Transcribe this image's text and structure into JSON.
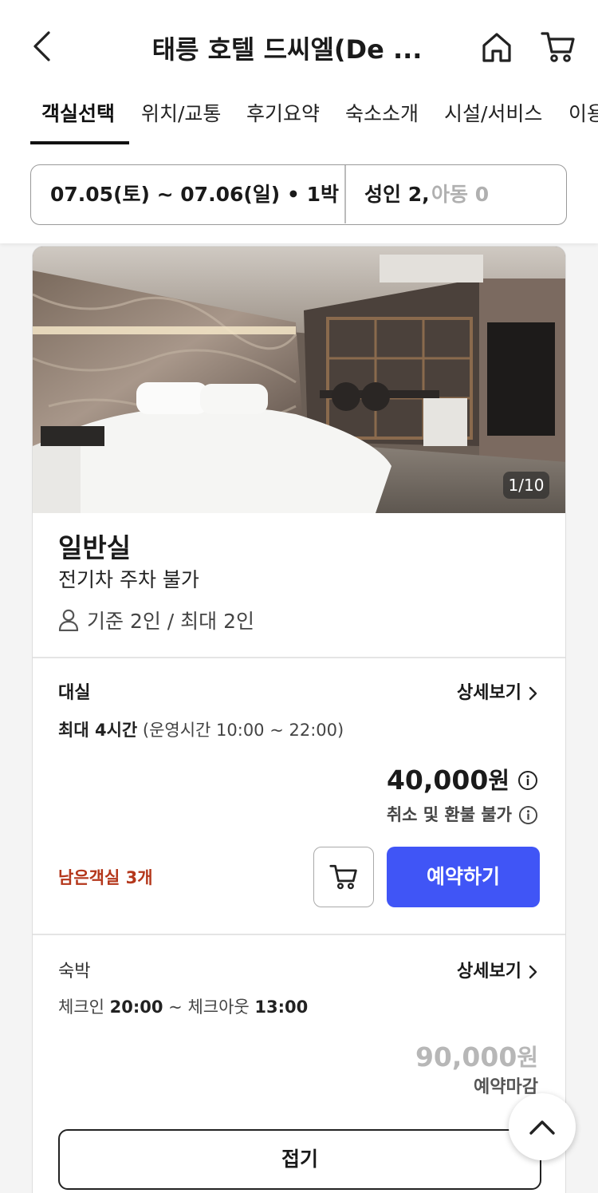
{
  "header": {
    "title": "태릉 호텔 드씨엘(De ...",
    "icons": {
      "back": "chevron-left-icon",
      "home": "home-icon",
      "cart": "cart-icon"
    }
  },
  "tabs": [
    {
      "label": "객실선택",
      "active": true
    },
    {
      "label": "위치/교통"
    },
    {
      "label": "후기요약"
    },
    {
      "label": "숙소소개"
    },
    {
      "label": "시설/서비스"
    },
    {
      "label": "이용"
    }
  ],
  "booking": {
    "dates": "07.05(토) ~ 07.06(일) • 1박",
    "adults": "성인 2,",
    "children": "아동 0"
  },
  "room": {
    "photo_counter": "1/10",
    "name": "일반실",
    "note": "전기차 주차 불가",
    "capacity": "기준 2인 / 최대 2인",
    "capacity_icon": "person-icon"
  },
  "offers": {
    "rental": {
      "title": "대실",
      "detail_label": "상세보기",
      "desc_bold": "최대 4시간",
      "desc_rest": " (운영시간 10:00 ~ 22:00)",
      "price": "40,000",
      "price_unit": "원",
      "policy": "취소 및 환불 불가",
      "remaining": "남은객실 3개",
      "reserve_label": "예약하기"
    },
    "stay": {
      "title": "숙박",
      "detail_label": "상세보기",
      "checkin_label": "체크인 ",
      "checkin_time": "20:00",
      "separator": " ~ ",
      "checkout_label": "체크아웃 ",
      "checkout_time": "13:00",
      "price": "90,000",
      "price_unit": "원",
      "status": "예약마감"
    }
  },
  "fold_label": "접기",
  "colors": {
    "accent": "#4055f6",
    "remaining": "#b4371b",
    "closed": "#b7b7b7"
  }
}
